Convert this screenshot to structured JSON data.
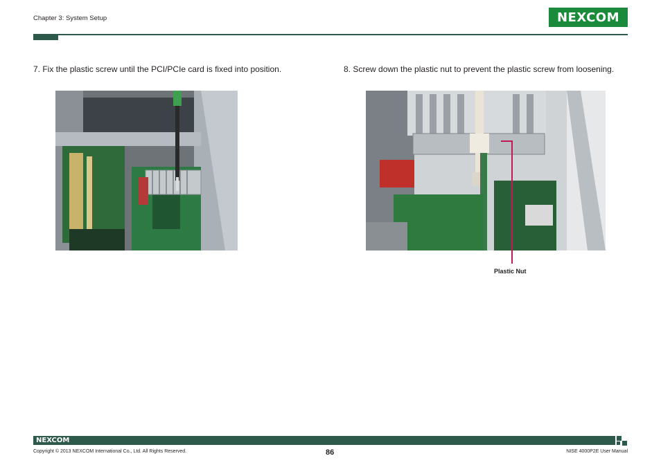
{
  "header": {
    "chapter": "Chapter 3: System Setup",
    "logo_text": "NEXCOM"
  },
  "steps": [
    {
      "text": "7. Fix the plastic screw until the PCI/PCIe card is fixed into position."
    },
    {
      "text": "8. Screw down the plastic nut to prevent the plastic screw from loosening."
    }
  ],
  "callout": {
    "label": "Plastic Nut",
    "color": "#c2185b"
  },
  "footer": {
    "logo_text": "NEXCOM",
    "copyright": "Copyright © 2013 NEXCOM International Co., Ltd. All Rights Reserved.",
    "page_number": "86",
    "manual_name": "NISE 4000P2E User Manual"
  },
  "colors": {
    "brand_green": "#1b8a3a",
    "rule_dark_green": "#2d5a4a"
  }
}
